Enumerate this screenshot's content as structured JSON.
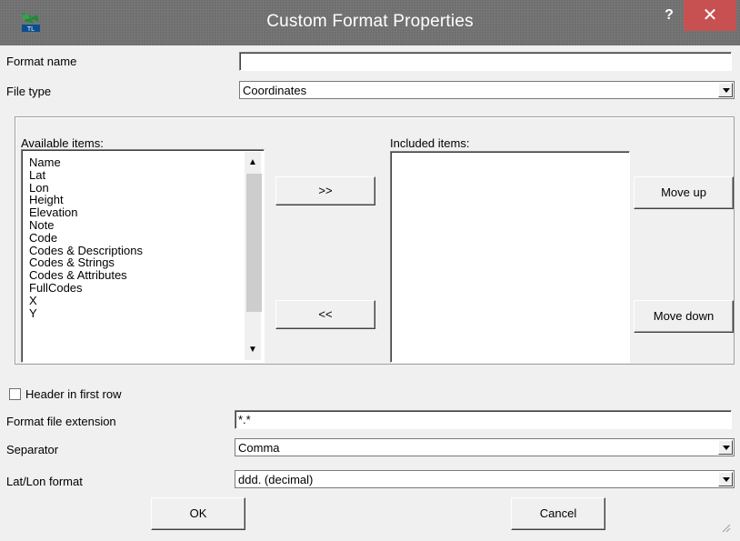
{
  "window": {
    "title": "Custom Format Properties",
    "help_symbol": "?",
    "close_symbol": "✕",
    "app_icon_text": "TL"
  },
  "form": {
    "format_name_label": "Format name",
    "format_name_value": "",
    "file_type_label": "File type",
    "file_type_value": "Coordinates",
    "available_label": "Available items:",
    "available_items": [
      "Name",
      "Lat",
      "Lon",
      "Height",
      "Elevation",
      "Note",
      "Code",
      "Codes & Descriptions",
      "Codes & Strings",
      "Codes & Attributes",
      "FullCodes",
      "X",
      "Y"
    ],
    "included_label": "Included items:",
    "included_items": [],
    "add_button": ">>",
    "remove_button": "<<",
    "move_up_button": "Move up",
    "move_down_button": "Move down",
    "header_checkbox_label": "Header in first row",
    "header_checked": false,
    "extension_label": "Format file extension",
    "extension_value": "*.*",
    "separator_label": "Separator",
    "separator_value": "Comma",
    "latlon_label": "Lat/Lon format",
    "latlon_value": "ddd. (decimal)",
    "ok_button": "OK",
    "cancel_button": "Cancel"
  },
  "colors": {
    "titlebar": "#6f6f6f",
    "close_button": "#c75050",
    "window_bg": "#f0f0f0"
  }
}
